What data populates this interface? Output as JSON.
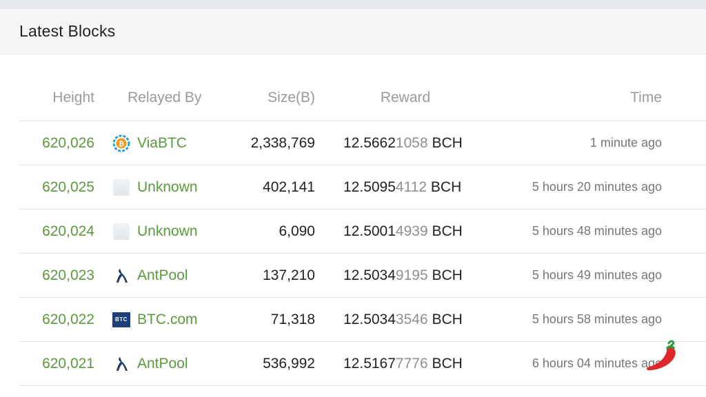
{
  "panel": {
    "title": "Latest Blocks"
  },
  "columns": {
    "height": "Height",
    "relayed_by": "Relayed By",
    "size": "Size(B)",
    "reward": "Reward",
    "time": "Time"
  },
  "rows": [
    {
      "height": "620,026",
      "relayed_by": "ViaBTC",
      "icon": "viabtc-icon",
      "size": "2,338,769",
      "reward_main": "12.5662",
      "reward_dim": "1058",
      "reward_unit": " BCH",
      "time": "1 minute ago"
    },
    {
      "height": "620,025",
      "relayed_by": "Unknown",
      "icon": "unknown-pool-icon",
      "size": "402,141",
      "reward_main": "12.5095",
      "reward_dim": "4112",
      "reward_unit": " BCH",
      "time": "5 hours 20 minutes ago"
    },
    {
      "height": "620,024",
      "relayed_by": "Unknown",
      "icon": "unknown-pool-icon",
      "size": "6,090",
      "reward_main": "12.5001",
      "reward_dim": "4939",
      "reward_unit": " BCH",
      "time": "5 hours 48 minutes ago"
    },
    {
      "height": "620,023",
      "relayed_by": "AntPool",
      "icon": "antpool-icon",
      "size": "137,210",
      "reward_main": "12.5034",
      "reward_dim": "9195",
      "reward_unit": " BCH",
      "time": "5 hours 49 minutes ago"
    },
    {
      "height": "620,022",
      "relayed_by": "BTC.com",
      "icon": "btccom-icon",
      "size": "71,318",
      "reward_main": "12.5034",
      "reward_dim": "3546",
      "reward_unit": " BCH",
      "time": "5 hours 58 minutes ago"
    },
    {
      "height": "620,021",
      "relayed_by": "AntPool",
      "icon": "antpool-icon",
      "size": "536,992",
      "reward_main": "12.5167",
      "reward_dim": "7776",
      "reward_unit": " BCH",
      "time": "6 hours 04 minutes ago"
    }
  ],
  "icons": {
    "btccom_logo_text": "BTC"
  },
  "colors": {
    "link_green": "#5a9a3c",
    "header_bg": "#f5f5f5",
    "reward_dim": "#8f8f8f"
  }
}
